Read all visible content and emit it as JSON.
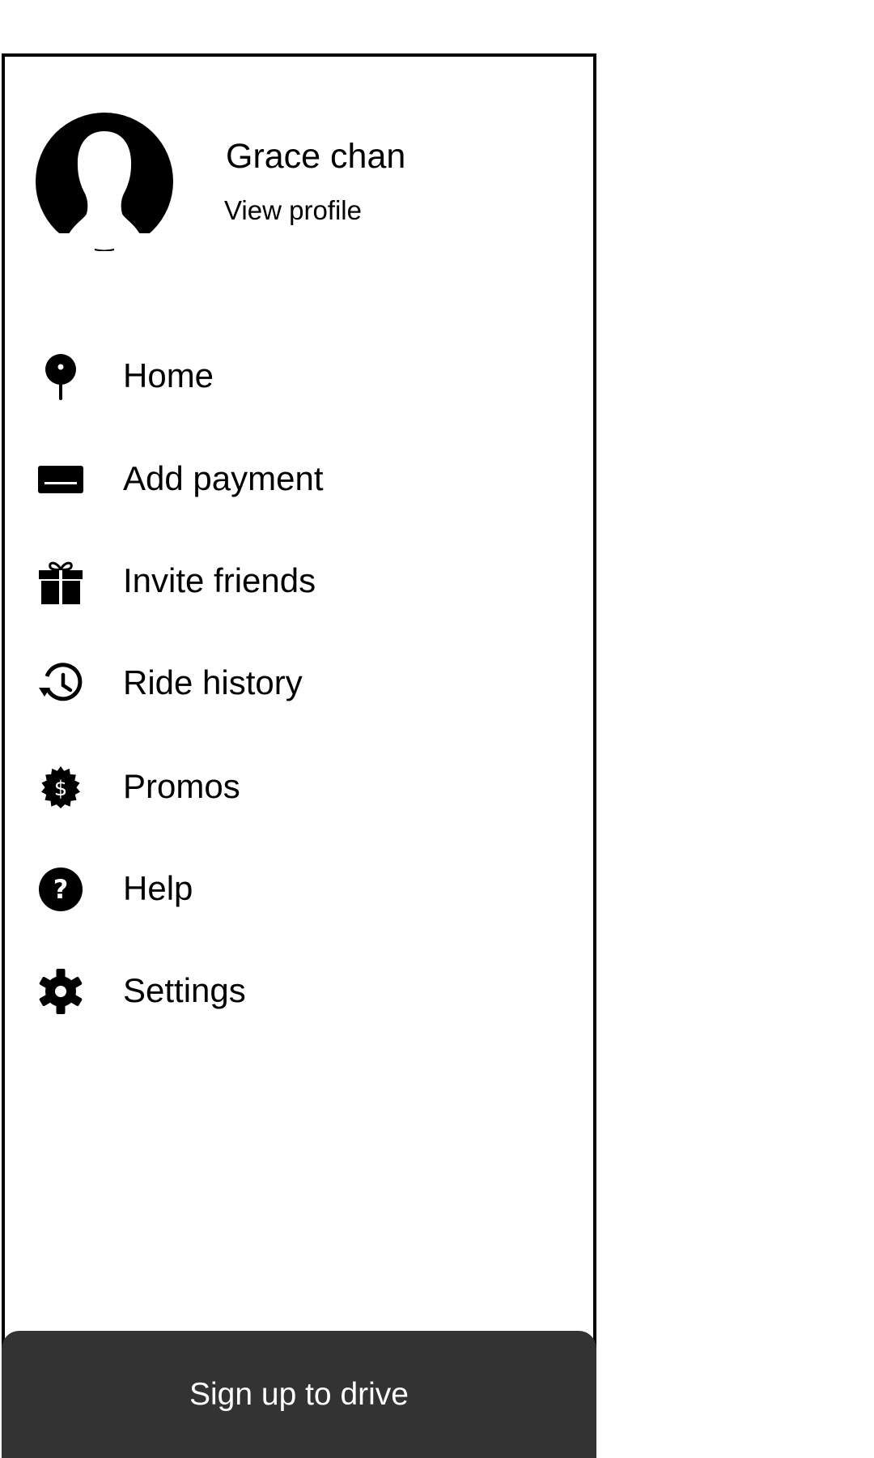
{
  "profile": {
    "name": "Grace chan",
    "view_profile_label": "View profile"
  },
  "menu": {
    "items": [
      {
        "label": "Home",
        "icon": "pin-icon"
      },
      {
        "label": "Add payment",
        "icon": "card-icon"
      },
      {
        "label": "Invite friends",
        "icon": "gift-icon"
      },
      {
        "label": "Ride history",
        "icon": "history-icon"
      },
      {
        "label": "Promos",
        "icon": "dollar-badge-icon"
      },
      {
        "label": "Help",
        "icon": "help-icon"
      },
      {
        "label": "Settings",
        "icon": "gear-icon"
      }
    ]
  },
  "footer": {
    "signup_label": "Sign up to drive"
  },
  "colors": {
    "background": "#ffffff",
    "border": "#000000",
    "button_background": "#333333",
    "button_text": "#ffffff"
  }
}
